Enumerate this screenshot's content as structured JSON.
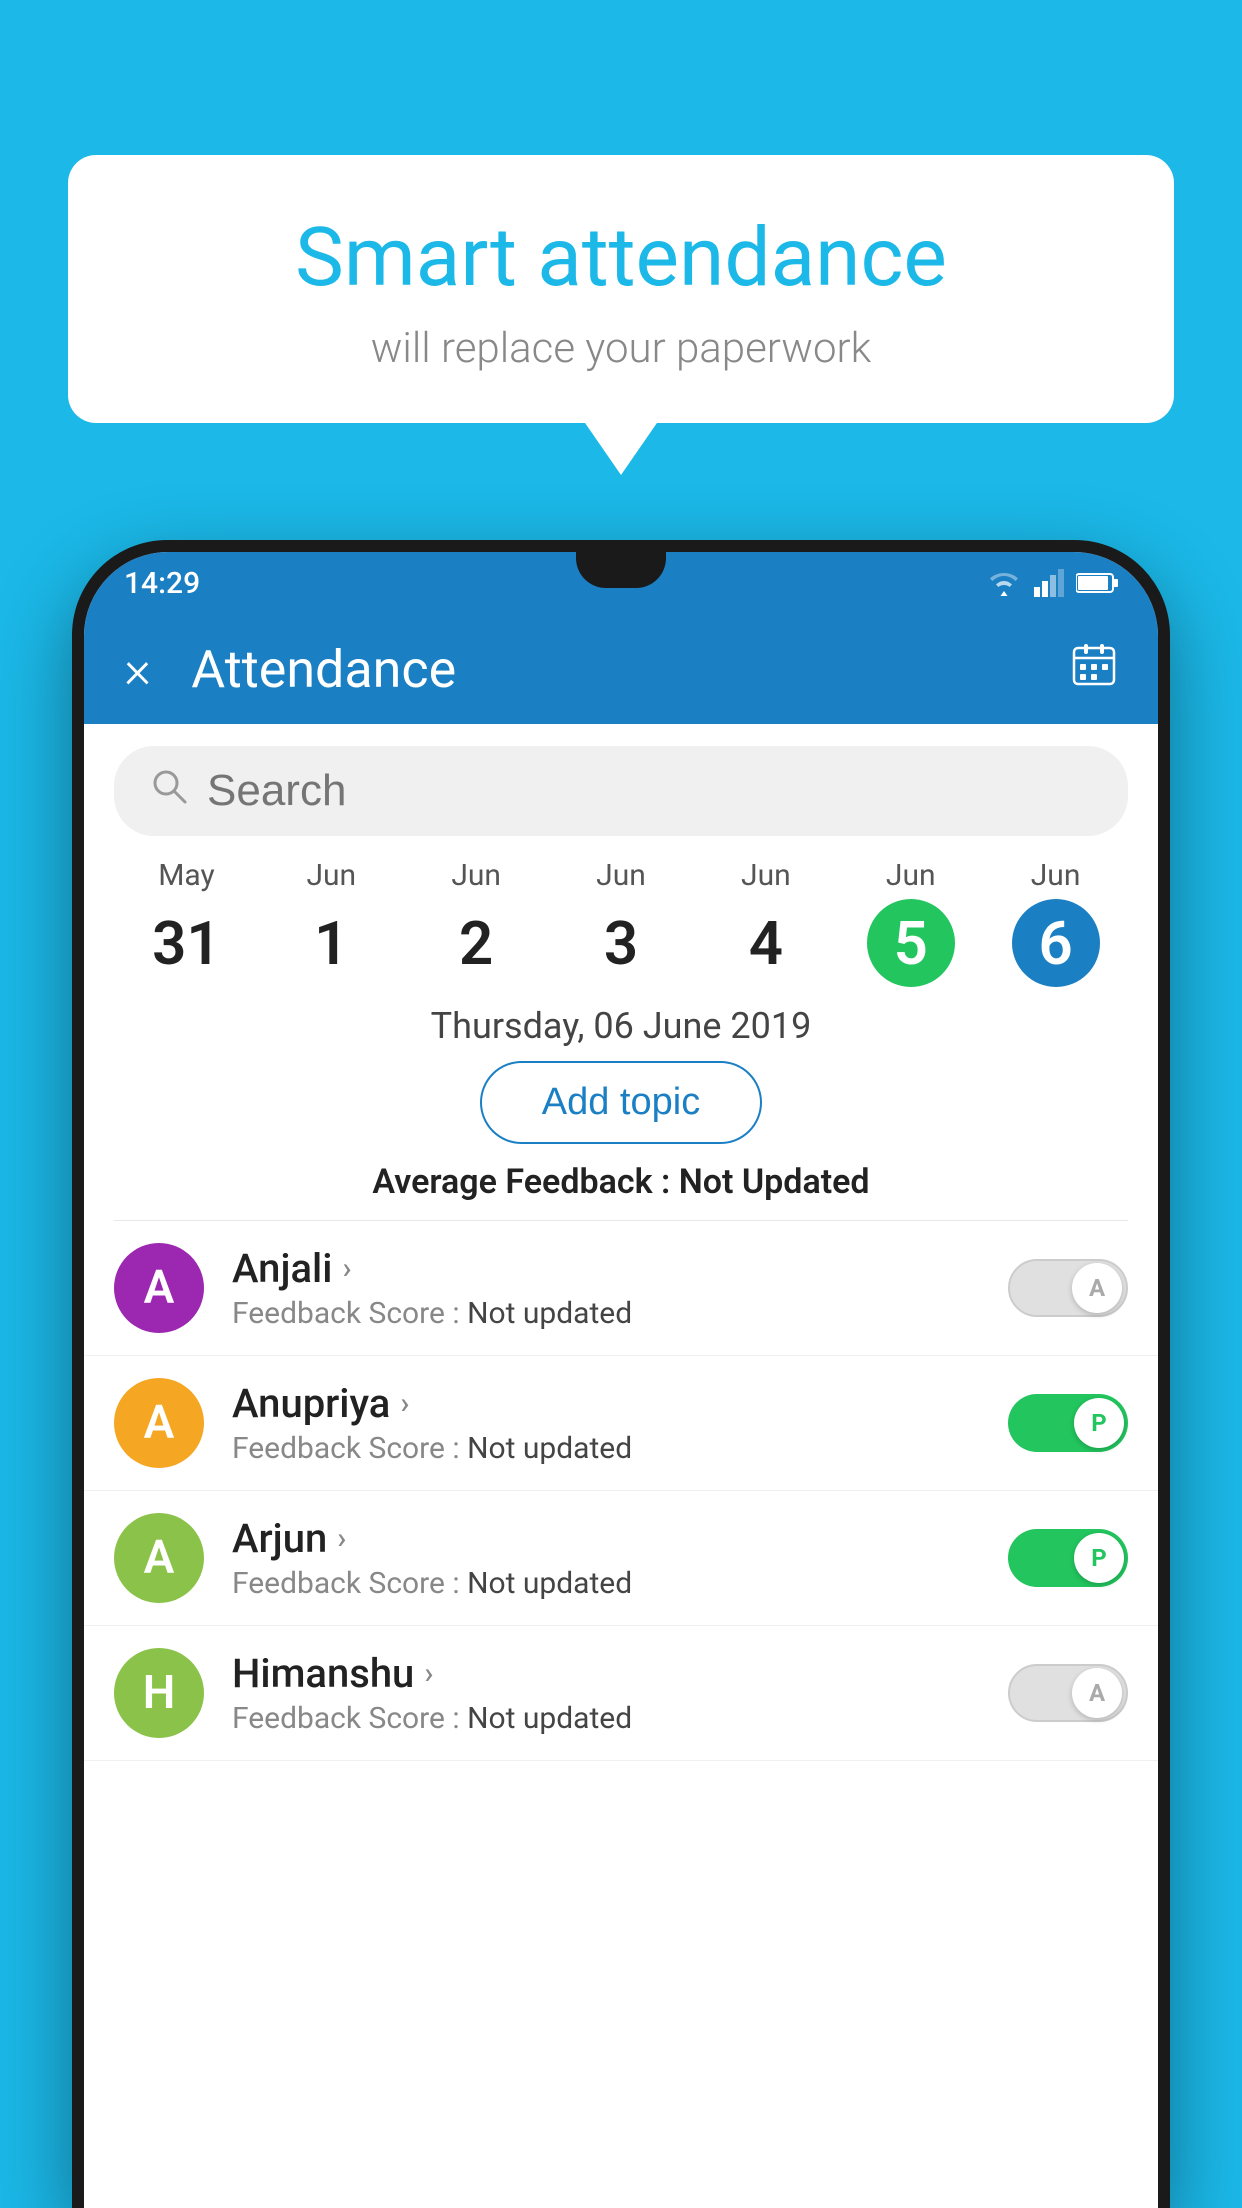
{
  "background_color": "#1bb8e8",
  "speech_bubble": {
    "title": "Smart attendance",
    "subtitle": "will replace your paperwork"
  },
  "status_bar": {
    "time": "14:29",
    "icons": [
      "wifi",
      "signal",
      "battery"
    ]
  },
  "app_bar": {
    "title": "Attendance",
    "close_label": "×",
    "calendar_icon": "📅"
  },
  "search": {
    "placeholder": "Search"
  },
  "dates": [
    {
      "month": "May",
      "day": "31",
      "style": "normal"
    },
    {
      "month": "Jun",
      "day": "1",
      "style": "normal"
    },
    {
      "month": "Jun",
      "day": "2",
      "style": "normal"
    },
    {
      "month": "Jun",
      "day": "3",
      "style": "normal"
    },
    {
      "month": "Jun",
      "day": "4",
      "style": "normal"
    },
    {
      "month": "Jun",
      "day": "5",
      "style": "active-green"
    },
    {
      "month": "Jun",
      "day": "6",
      "style": "active-blue"
    }
  ],
  "selected_date": "Thursday, 06 June 2019",
  "add_topic_label": "Add topic",
  "avg_feedback_label": "Average Feedback :",
  "avg_feedback_value": "Not Updated",
  "students": [
    {
      "name": "Anjali",
      "avatar_letter": "A",
      "avatar_color": "#9c27b0",
      "feedback_label": "Feedback Score :",
      "feedback_value": "Not updated",
      "toggle_state": "off",
      "toggle_letter": "A"
    },
    {
      "name": "Anupriya",
      "avatar_letter": "A",
      "avatar_color": "#f5a623",
      "feedback_label": "Feedback Score :",
      "feedback_value": "Not updated",
      "toggle_state": "on",
      "toggle_letter": "P"
    },
    {
      "name": "Arjun",
      "avatar_letter": "A",
      "avatar_color": "#8bc34a",
      "feedback_label": "Feedback Score :",
      "feedback_value": "Not updated",
      "toggle_state": "on",
      "toggle_letter": "P"
    },
    {
      "name": "Himanshu",
      "avatar_letter": "H",
      "avatar_color": "#8bc34a",
      "feedback_label": "Feedback Score :",
      "feedback_value": "Not updated",
      "toggle_state": "off",
      "toggle_letter": "A"
    }
  ]
}
